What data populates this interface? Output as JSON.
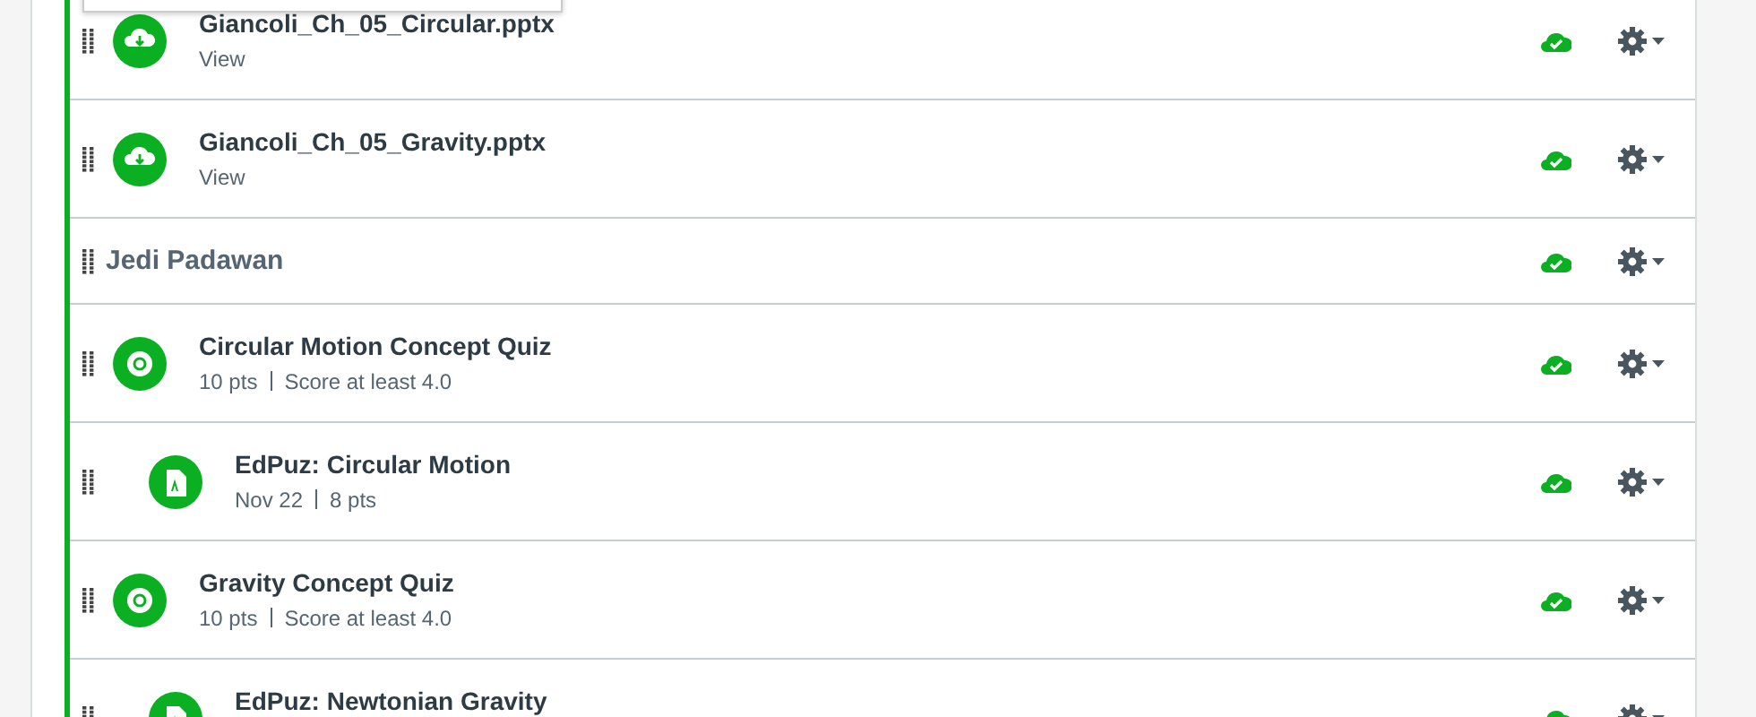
{
  "module_items": [
    {
      "kind": "file",
      "title": "Giancoli_Ch_05_Circular.pptx",
      "details": [
        "View"
      ],
      "published": true
    },
    {
      "kind": "file",
      "title": "Giancoli_Ch_05_Gravity.pptx",
      "details": [
        "View"
      ],
      "published": true
    },
    {
      "kind": "header",
      "title": "Jedi Padawan",
      "published": true,
      "children": [
        {
          "kind": "quiz",
          "title": "Circular Motion Concept Quiz",
          "details": [
            "10 pts",
            "Score at least 4.0"
          ],
          "published": true,
          "children": [
            {
              "kind": "assignment",
              "title": "EdPuz: Circular Motion",
              "details": [
                "Nov 22",
                "8 pts"
              ],
              "published": true
            }
          ]
        },
        {
          "kind": "quiz",
          "title": "Gravity Concept Quiz",
          "details": [
            "10 pts",
            "Score at least 4.0"
          ],
          "published": true,
          "children": [
            {
              "kind": "assignment",
              "title": "EdPuz: Newtonian Gravity",
              "published": true
            }
          ]
        }
      ]
    }
  ]
}
